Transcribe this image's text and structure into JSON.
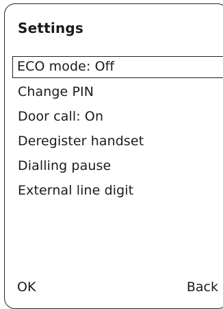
{
  "header": {
    "title": "Settings"
  },
  "menu": {
    "items": [
      {
        "label": "ECO mode: Off"
      },
      {
        "label": "Change PIN"
      },
      {
        "label": "Door call: On"
      },
      {
        "label": "Deregister handset"
      },
      {
        "label": "Dialling pause"
      },
      {
        "label": "External line digit"
      }
    ],
    "selected_index": 0
  },
  "softkeys": {
    "left": "OK",
    "right": "Back"
  }
}
